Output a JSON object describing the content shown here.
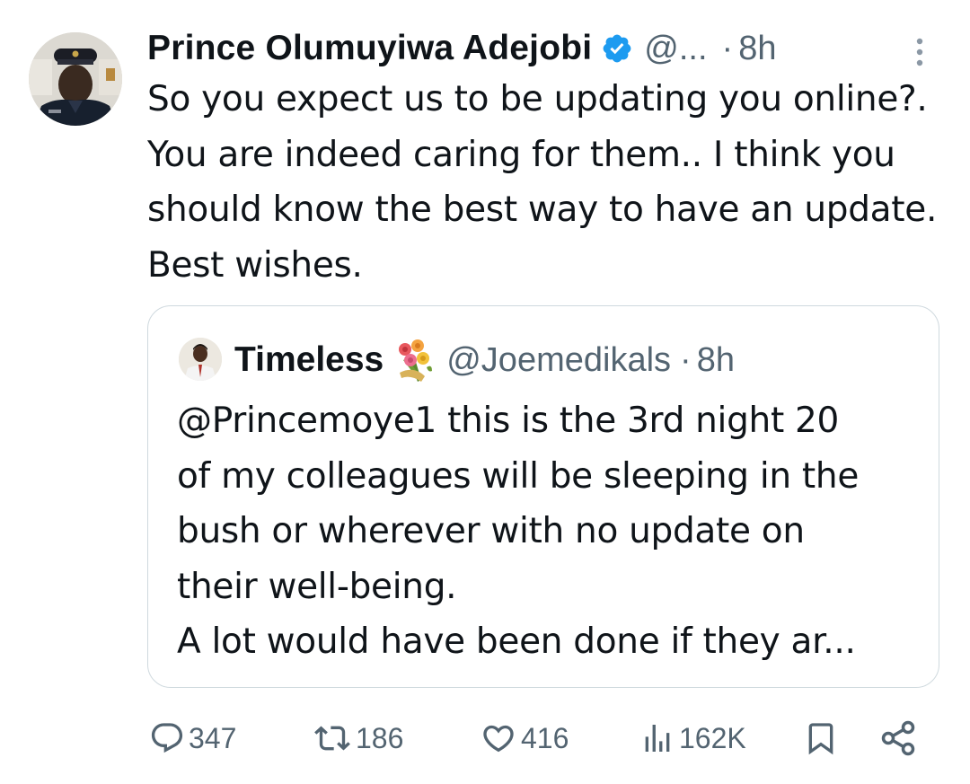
{
  "tweet": {
    "author_name": "Prince Olumuyiwa Adejobi",
    "verified_icon": "verified-badge-icon",
    "handle": "@...",
    "dot": "·",
    "time": "8h",
    "text": "So you expect us to be updating you online?. You are indeed caring for them.. I think you should know the best way to have an update. Best wishes."
  },
  "quote": {
    "author_name": "Timeless",
    "emoji_icon": "bouquet-icon",
    "handle": "@Joemedikals",
    "dot": "·",
    "time": "8h",
    "lines": [
      "@Princemoye1 this is the 3rd night 20",
      "of my colleagues will be sleeping in the",
      "bush or wherever with no update on",
      "their well-being.",
      "A lot would have been done if they ar..."
    ]
  },
  "actions": {
    "replies": "347",
    "reposts": "186",
    "likes": "416",
    "views": "162K"
  },
  "colors": {
    "text": "#0f1419",
    "secondary": "#536471",
    "verified": "#1d9bf0",
    "border": "#cfd9de"
  }
}
